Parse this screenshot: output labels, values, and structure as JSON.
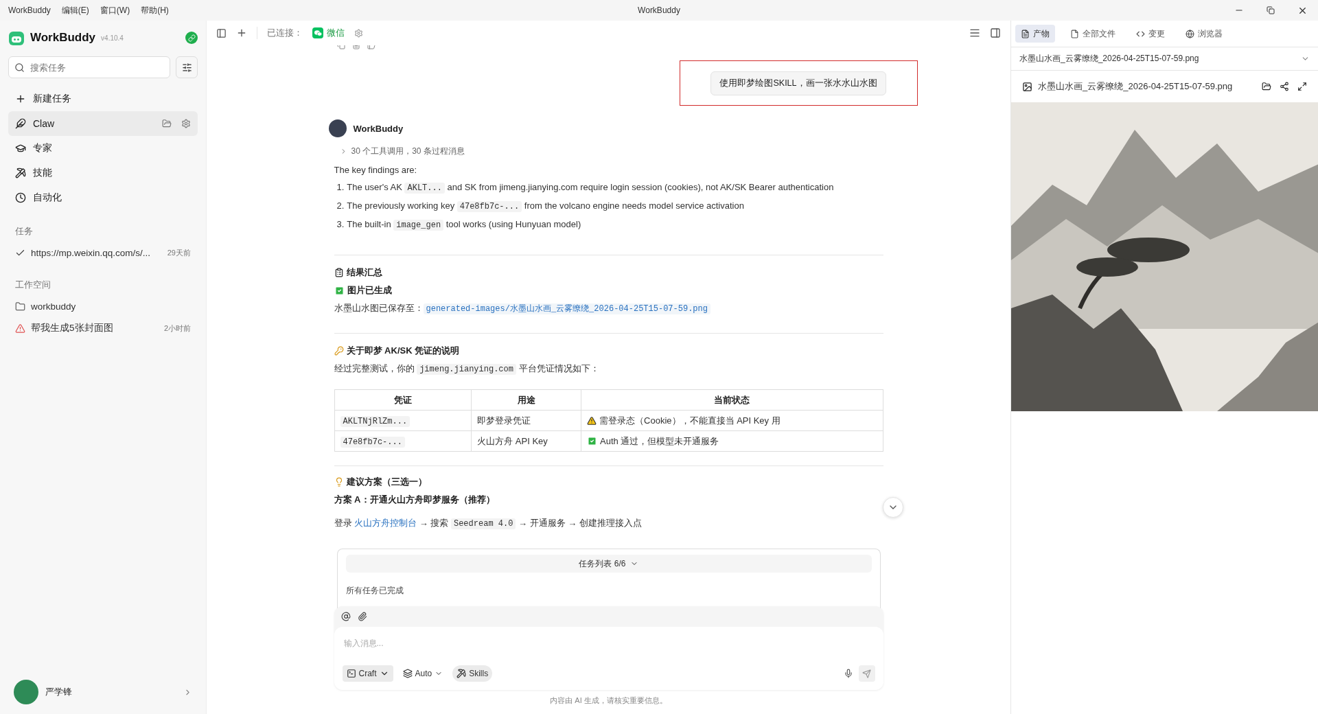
{
  "menu": [
    "WorkBuddy",
    "编辑(E)",
    "窗口(W)",
    "帮助(H)"
  ],
  "window": {
    "title": "WorkBuddy"
  },
  "sidebar": {
    "app_name": "WorkBuddy",
    "version": "v4.10.4",
    "search": {
      "placeholder": "搜索任务"
    },
    "nav": [
      {
        "kind": "new",
        "label": "新建任务",
        "selected": false
      },
      {
        "kind": "claw",
        "label": "Claw",
        "selected": true
      },
      {
        "kind": "expert",
        "label": "专家",
        "selected": false
      },
      {
        "kind": "skill",
        "label": "技能",
        "selected": false
      },
      {
        "kind": "automation",
        "label": "自动化",
        "selected": false
      }
    ],
    "sections": [
      {
        "title": "任务",
        "items": [
          {
            "kind": "done",
            "label": "https://mp.weixin.qq.com/s/...",
            "time": "29天前"
          }
        ]
      },
      {
        "title": "工作空间",
        "items": [
          {
            "kind": "folder",
            "label": "workbuddy"
          },
          {
            "kind": "warning",
            "label": "帮我生成5张封面图",
            "time": "2小时前"
          }
        ]
      }
    ],
    "user": {
      "name": "严学锋"
    }
  },
  "toolbar": {
    "connected_label": "已连接：",
    "channel": "微信"
  },
  "chat": {
    "user_message": "使用即梦绘图SKILL，画一张水水山水图",
    "assistant_name": "WorkBuddy",
    "tool_summary": "30 个工具调用，30 条过程消息",
    "intro": "The key findings are:",
    "findings": [
      {
        "marker": "1.",
        "segs": [
          {
            "t": "The user's AK "
          },
          {
            "code": "AKLT..."
          },
          {
            "t": " and SK from jimeng.jianying.com require login session (cookies), not AK/SK Bearer authentication"
          }
        ]
      },
      {
        "marker": "2.",
        "segs": [
          {
            "t": "The previously working key "
          },
          {
            "code": "47e8fb7c-..."
          },
          {
            "t": " from the volcano engine needs model service activation"
          }
        ]
      },
      {
        "marker": "3.",
        "segs": [
          {
            "t": "The built-in "
          },
          {
            "code": "image_gen"
          },
          {
            "t": " tool works (using Hunyuan model)"
          }
        ]
      }
    ],
    "result": {
      "heading": "结果汇总",
      "status": "图片已生成",
      "saved_label": "水墨山水图已保存至：",
      "saved_path": "generated-images/水墨山水画_云雾缭绕_2026-04-25T15-07-59.png"
    },
    "credentials": {
      "heading": "关于即梦 AK/SK 凭证的说明",
      "intro": [
        {
          "t": "经过完整测试，你的 "
        },
        {
          "code": "jimeng.jianying.com"
        },
        {
          "t": " 平台凭证情况如下："
        }
      ],
      "table": {
        "columns": [
          "凭证",
          "用途",
          "当前状态"
        ],
        "rows": [
          {
            "credential": "AKLTNjRlZm...",
            "usage": "即梦登录凭证",
            "ok": false,
            "status": "需登录态（Cookie），不能直接当 API Key 用"
          },
          {
            "credential": "47e8fb7c-...",
            "usage": "火山方舟 API Key",
            "ok": true,
            "status": "Auth 通过，但模型未开通服务"
          }
        ]
      }
    },
    "suggestion": {
      "heading": "建议方案（三选一）",
      "plan": "方案 A：开通火山方舟即梦服务（推荐）",
      "steps": [
        {
          "t": "登录 "
        },
        {
          "link": "火山方舟控制台"
        },
        {
          "t": " → 搜索 "
        },
        {
          "code": "Seedream 4.0"
        },
        {
          "t": " → 开通服务 → 创建推理接入点"
        }
      ]
    }
  },
  "task_panel": {
    "title": "任务列表 6/6",
    "summary": "所有任务已完成"
  },
  "composer": {
    "placeholder": "输入消息...",
    "mode": "Craft",
    "model": "Auto",
    "skills": "Skills"
  },
  "footer": "内容由 AI 生成，请核实重要信息。",
  "right_panel": {
    "tabs": [
      {
        "kind": "artifact",
        "label": "产物",
        "selected": true
      },
      {
        "kind": "files",
        "label": "全部文件",
        "selected": false
      },
      {
        "kind": "changes",
        "label": "变更",
        "selected": false
      },
      {
        "kind": "browser",
        "label": "浏览器",
        "selected": false
      }
    ],
    "file_select": "水墨山水画_云雾缭绕_2026-04-25T15-07-59.png",
    "file_title": "水墨山水画_云雾缭绕_2026-04-25T15-07-59.png"
  }
}
